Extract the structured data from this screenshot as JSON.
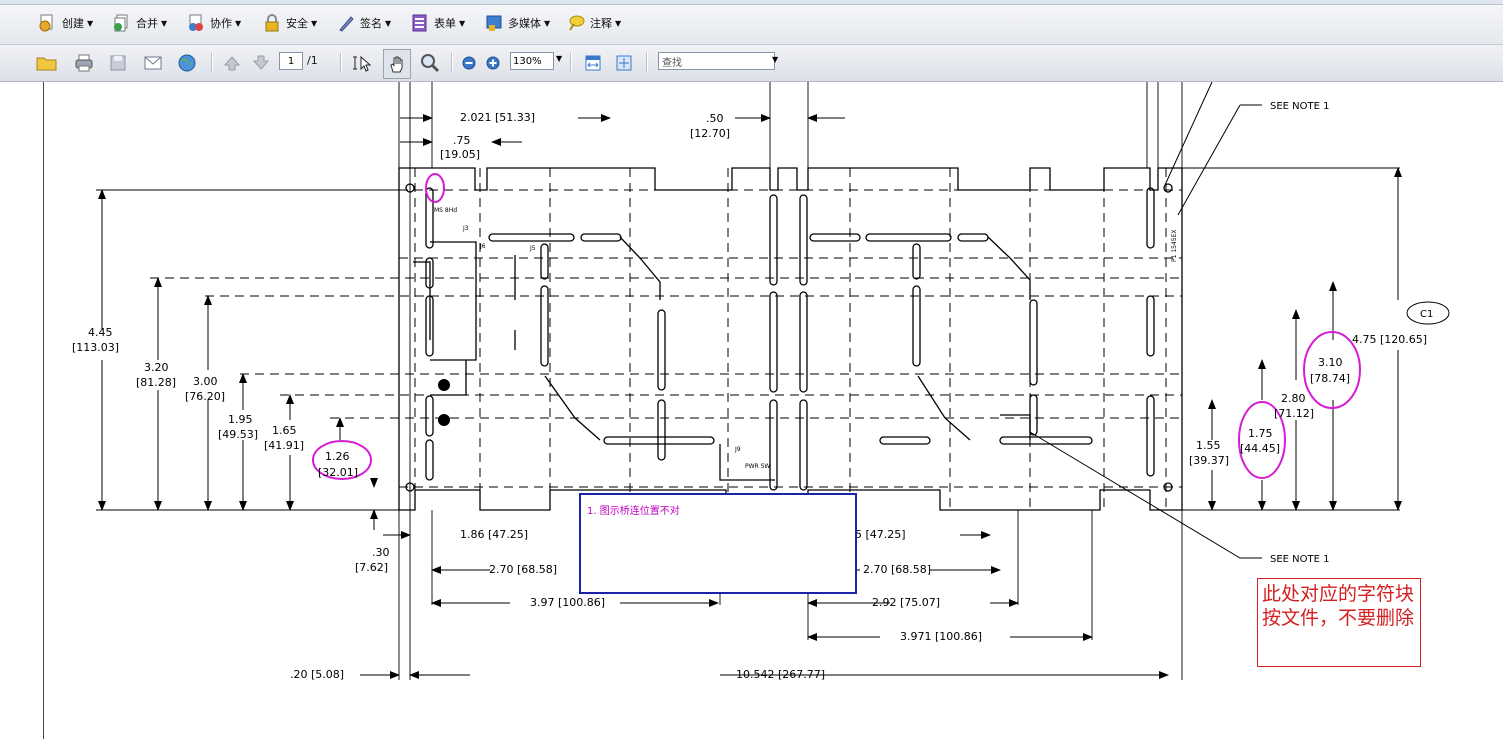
{
  "toolbar_top": {
    "items": [
      {
        "label": "创建",
        "icon": "create-icon"
      },
      {
        "label": "合并",
        "icon": "merge-icon"
      },
      {
        "label": "协作",
        "icon": "collaborate-icon"
      },
      {
        "label": "安全",
        "icon": "lock-icon"
      },
      {
        "label": "签名",
        "icon": "pen-icon"
      },
      {
        "label": "表单",
        "icon": "form-icon"
      },
      {
        "label": "多媒体",
        "icon": "multimedia-icon"
      },
      {
        "label": "注释",
        "icon": "comment-icon"
      }
    ]
  },
  "toolbar_bottom": {
    "page_current": "1",
    "page_total": "/1",
    "zoom": "130%",
    "search_placeholder": "查找"
  },
  "drawing": {
    "dims": {
      "d1": "2.021 [51.33]",
      "d2": ".75",
      "d2b": "[19.05]",
      "d3": ".50",
      "d3b": "[12.70]",
      "d4": "4.45",
      "d4b": "[113.03]",
      "d5": "3.20",
      "d5b": "[81.28]",
      "d6": "3.00",
      "d6b": "[76.20]",
      "d7": "1.95",
      "d7b": "[49.53]",
      "d8": "1.65",
      "d8b": "[41.91]",
      "d9": "1.26",
      "d9b": "[32.01]",
      "d10": ".30",
      "d10b": "[7.62]",
      "d11": "1.86 [47.25]",
      "d12": "2.70 [68.58]",
      "d13": "3.97 [100.86]",
      "d14": ".20 [5.08]",
      "d15": "10.542 [267.77]",
      "d16": "5 [47.25]",
      "d17": "2.70 [68.58]",
      "d18": "2.92 [75.07]",
      "d19": "3.971 [100.86]",
      "d20": "1.55",
      "d20b": "[39.37]",
      "d21": "1.75",
      "d21b": "[44.45]",
      "d22": "2.80",
      "d22b": "[71.12]",
      "d23": "3.10",
      "d23b": "[78.74]",
      "d24": "4.75 [120.65]",
      "note1": "SEE NOTE 1",
      "note2": "SEE NOTE 1",
      "c1": "C1",
      "part": "P1 1545EX",
      "lbl_ms": "MS 8Hd",
      "lbl_j3": "J3",
      "lbl_j6": "J6",
      "lbl_j5": "J5",
      "lbl_j9": "J9",
      "lbl_pwr": "PWR SW"
    }
  },
  "comment": {
    "text": "1. 图示桥连位置不对"
  },
  "note": {
    "text": "此处对应的字符块按文件，不要删除"
  }
}
